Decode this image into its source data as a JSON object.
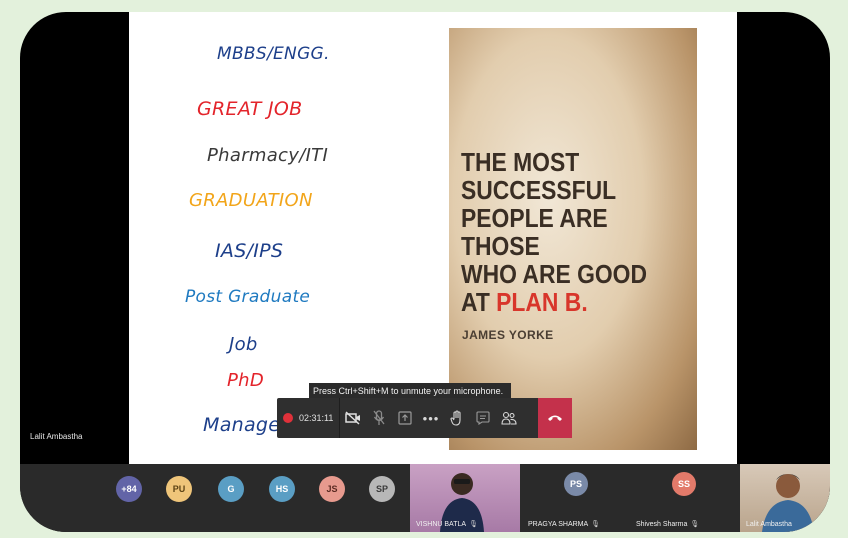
{
  "slide": {
    "careers": [
      {
        "text": "MBBS/ENGG.",
        "color": "#1d3f8a"
      },
      {
        "text": "GREAT JOB",
        "color": "#e3242b"
      },
      {
        "text": "Pharmacy/ITI",
        "color": "#3a3a3a"
      },
      {
        "text": "GRADUATION",
        "color": "#f2a51a"
      },
      {
        "text": "IAS/IPS",
        "color": "#1d3f8a"
      },
      {
        "text": "Post Graduate",
        "color": "#1f7ac0"
      },
      {
        "text": "Job",
        "color": "#1d3f8a"
      },
      {
        "text": "PhD",
        "color": "#e3242b"
      },
      {
        "text": "Manager",
        "color": "#1d3f8a"
      }
    ],
    "poster": {
      "line1": "THE MOST",
      "line2": "SUCCESSFUL",
      "line3": "PEOPLE ARE THOSE",
      "line4": "WHO ARE GOOD",
      "line5_prefix": "AT ",
      "line5_highlight": "PLAN B.",
      "author": "JAMES YORKE"
    }
  },
  "presenter_name": "Lalit Ambastha",
  "tooltip": "Press Ctrl+Shift+M to unmute your microphone.",
  "toolbar": {
    "timer": "02:31:11",
    "buttons": [
      "camera-off-icon",
      "mic-muted-icon",
      "share-icon",
      "more-icon",
      "raise-hand-icon",
      "chat-icon",
      "participants-icon",
      "hang-up-icon"
    ]
  },
  "participants": {
    "overflow": "+84",
    "avatars": [
      {
        "initials": "PU",
        "color": "#efc57a",
        "text_color": "#5b4214"
      },
      {
        "initials": "G",
        "color": "#5a9ec4",
        "text_color": "#ffffff"
      },
      {
        "initials": "HS",
        "color": "#5a9ec4",
        "text_color": "#ffffff"
      },
      {
        "initials": "JS",
        "color": "#e79a8e",
        "text_color": "#5a2a22"
      },
      {
        "initials": "SP",
        "color": "#b7b7b7",
        "text_color": "#3a3a3a"
      }
    ],
    "tiles": [
      {
        "name": "VISHNU BATLA"
      },
      {
        "name": "PRAGYA SHARMA",
        "initials": "PS"
      },
      {
        "name": "Shivesh Sharma",
        "initials": "SS"
      },
      {
        "name": "Lalit Ambastha"
      }
    ]
  }
}
